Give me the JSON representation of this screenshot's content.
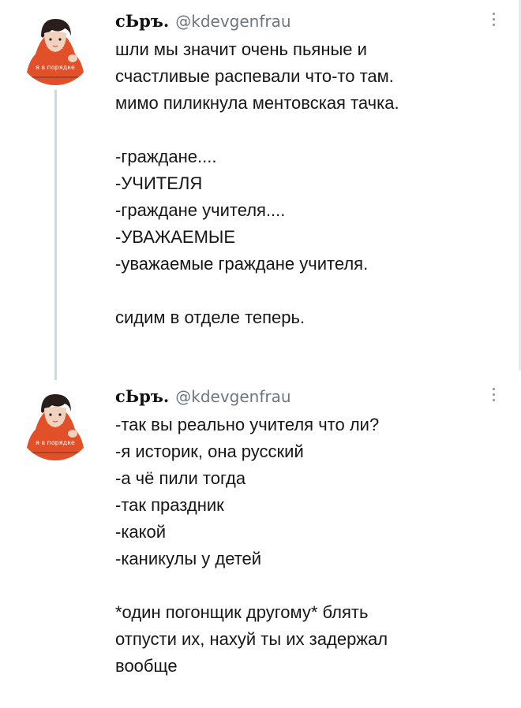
{
  "tweets": [
    {
      "display_name": "сЬръ.",
      "handle": "@kdevgenfrau",
      "avatar_icon": "avatar-image",
      "more_icon": "more-options-icon",
      "text": "шли мы значит очень пьяные и\nсчастливые распевали что-то там.\nмимо пиликнула ментовская тачка.\n\n-граждане....\n-УЧИТЕЛЯ\n-граждане учителя....\n-УВАЖАЕМЫЕ\n-уважаемые граждане учителя.\n\nсидим в отделе теперь."
    },
    {
      "display_name": "сЬръ.",
      "handle": "@kdevgenfrau",
      "avatar_icon": "avatar-image",
      "more_icon": "more-options-icon",
      "text": "-так вы реально учителя что ли?\n-я историк, она русский\n-а чё пили тогда\n-так праздник\n-какой\n-каникулы у детей\n\n*один погонщик другому* блять\nотпусти их, нахуй ты их задержал\nвообще"
    }
  ],
  "avatar": {
    "hoodie_text": "я в порядке"
  },
  "colors": {
    "handle": "#6b7680",
    "thread_line": "#cfd9de",
    "hoodie": "#e2502a"
  }
}
